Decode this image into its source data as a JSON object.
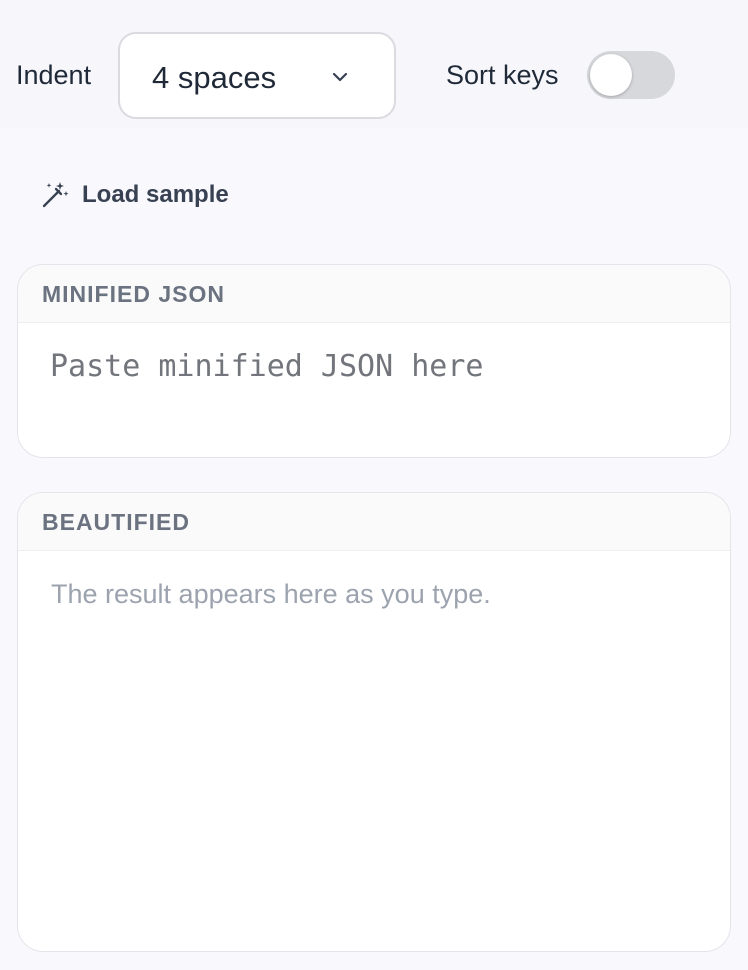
{
  "toolbar": {
    "indent_label": "Indent",
    "indent_value": "4 spaces",
    "sort_keys_label": "Sort keys",
    "sort_keys_on": false
  },
  "actions": {
    "load_sample_label": "Load sample",
    "load_sample_icon": "magic-wand-icon"
  },
  "input_panel": {
    "title": "MINIFIED JSON",
    "placeholder": "Paste minified JSON here",
    "value": ""
  },
  "output_panel": {
    "title": "BEAUTIFIED",
    "placeholder": "The result appears here as you type."
  },
  "colors": {
    "background": "#f9f9fd",
    "toggle_off": "#d6d8dc",
    "muted_text": "#6b7280"
  }
}
